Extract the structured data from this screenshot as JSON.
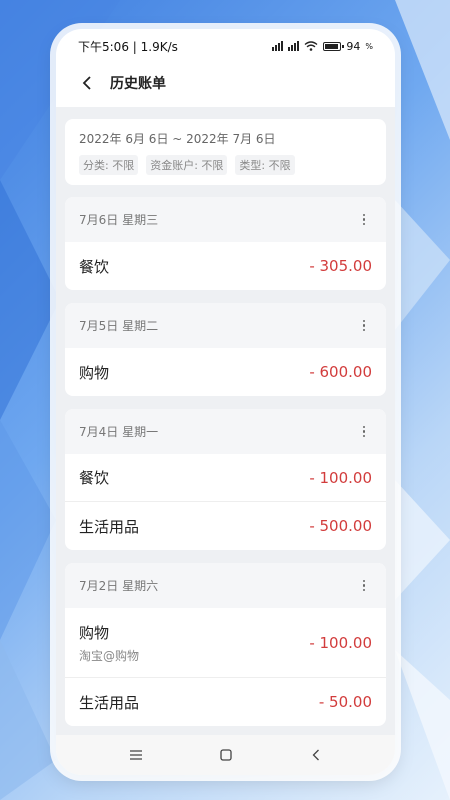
{
  "status_bar": {
    "time_speed": "下午5:06 | 1.9K/s",
    "battery": "94"
  },
  "header": {
    "title": "历史账单"
  },
  "filter": {
    "date_range": "2022年 6月 6日 ~ 2022年 7月 6日",
    "chips": [
      "分类: 不限",
      "资金账户: 不限",
      "类型: 不限"
    ]
  },
  "days": [
    {
      "label": "7月6日  星期三",
      "entries": [
        {
          "category": "餐饮",
          "amount": "- 305.00"
        }
      ]
    },
    {
      "label": "7月5日  星期二",
      "entries": [
        {
          "category": "购物",
          "amount": "- 600.00"
        }
      ]
    },
    {
      "label": "7月4日  星期一",
      "entries": [
        {
          "category": "餐饮",
          "amount": "- 100.00"
        },
        {
          "category": "生活用品",
          "amount": "- 500.00"
        }
      ]
    },
    {
      "label": "7月2日  星期六",
      "entries": [
        {
          "category": "购物",
          "note": "淘宝@购物",
          "amount": "- 100.00"
        },
        {
          "category": "生活用品",
          "amount": "- 50.00"
        }
      ]
    }
  ],
  "colors": {
    "accent_expense": "#d23c3c",
    "page_bg": "#eef0f3"
  },
  "icons": {
    "back": "back-arrow-icon",
    "more": "more-vertical-icon",
    "nav": [
      "menu-icon",
      "home-icon",
      "back-icon"
    ]
  }
}
